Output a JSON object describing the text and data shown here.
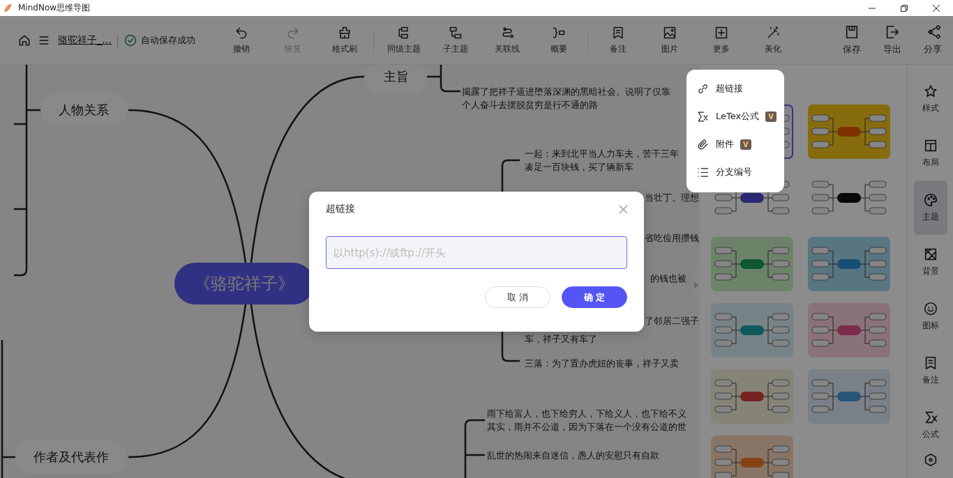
{
  "window": {
    "title": "MindNow思维导图"
  },
  "toolbar": {
    "document_name": "骆驼祥子_…",
    "save_status": "自动保存成功",
    "groups": [
      [
        {
          "label": "撤销",
          "disabled": false
        },
        {
          "label": "恢复",
          "disabled": true
        },
        {
          "label": "格式刷",
          "disabled": false
        }
      ],
      [
        {
          "label": "同级主题",
          "disabled": false
        },
        {
          "label": "子主题",
          "disabled": false
        },
        {
          "label": "关联线",
          "disabled": false
        },
        {
          "label": "概要",
          "disabled": false
        }
      ],
      [
        {
          "label": "备注",
          "disabled": false
        },
        {
          "label": "图片",
          "disabled": false
        },
        {
          "label": "更多",
          "disabled": false
        },
        {
          "label": "美化",
          "disabled": false
        }
      ]
    ],
    "actions": [
      {
        "label": "保存"
      },
      {
        "label": "导出"
      },
      {
        "label": "分享"
      }
    ]
  },
  "mind_map": {
    "central_topic": "《骆驼祥子》",
    "topics": [
      {
        "label": "人物关系"
      },
      {
        "label": "作者及代表作"
      },
      {
        "label": "主旨"
      }
    ],
    "theme_text": [
      "揭露了把祥子逼进堕落深渊的黑暗社会。说明了仅靠",
      "个人奋斗去摆脱贫穷是行不通的路"
    ],
    "plot_items": [
      [
        "一起：来到北平当人力车夫，苦干三年",
        "凑足一百块钱，买了辆新车"
      ],
      [
        "当壮丁。理想"
      ],
      [
        "省吃俭用攒钱"
      ],
      [
        "的钱也被"
      ],
      [
        "了邻居二强子"
      ],
      [
        "车，祥子又有车了"
      ],
      [
        "三落：为了置办虎妞的丧事，祥子又卖"
      ]
    ],
    "quote_items": [
      [
        "雨下给富人，也下给穷人，下给义人，也下给不义",
        "其实，雨并不公道，因为下落在一个没有公道的世"
      ],
      [
        "乱世的热闹来自迷信，愚人的安慰只有自欺"
      ]
    ]
  },
  "theme_panel": {
    "themes": [
      {
        "selected": true
      },
      {
        "selected": false
      },
      {
        "selected": false
      },
      {
        "selected": false
      },
      {
        "selected": false
      },
      {
        "selected": false
      },
      {
        "selected": false
      },
      {
        "selected": false
      },
      {
        "selected": false
      },
      {
        "selected": false
      },
      {
        "selected": false
      }
    ]
  },
  "sidebar": {
    "items": [
      {
        "label": "样式",
        "selected": false
      },
      {
        "label": "布局",
        "selected": false
      },
      {
        "label": "主题",
        "selected": true
      },
      {
        "label": "背景",
        "selected": false
      },
      {
        "label": "图标",
        "selected": false
      },
      {
        "label": "备注",
        "selected": false
      },
      {
        "label": "公式",
        "selected": false
      }
    ]
  },
  "more_menu": {
    "items": [
      {
        "label": "超链接"
      },
      {
        "label": "LeTex公式",
        "badge": "V"
      },
      {
        "label": "附件",
        "badge": "V"
      },
      {
        "label": "分支编号"
      }
    ]
  },
  "dialog": {
    "title": "超链接",
    "input": {
      "placeholder": "以http(s)://或ftp://开头"
    },
    "buttons": [
      {
        "label": "取 消",
        "kind": "secondary"
      },
      {
        "label": "确 定",
        "kind": "primary"
      }
    ]
  }
}
